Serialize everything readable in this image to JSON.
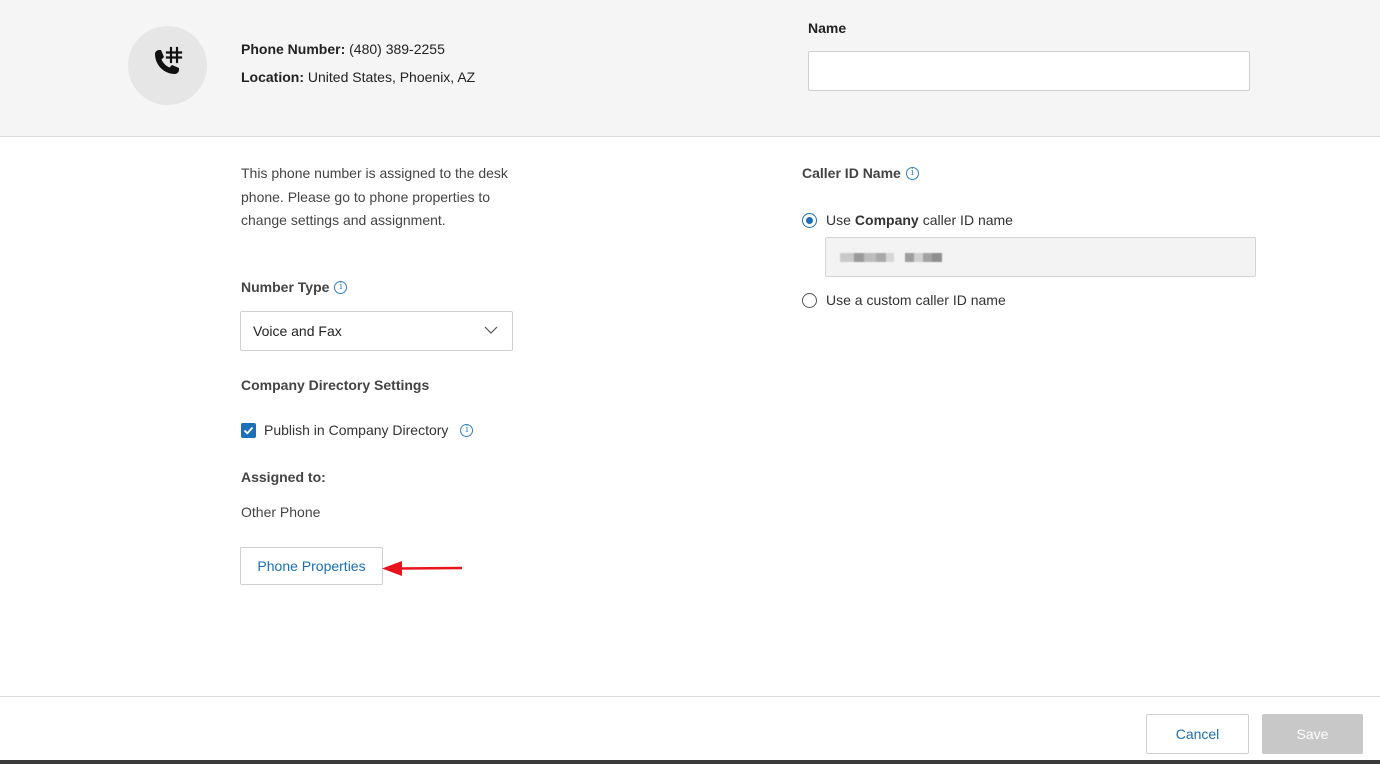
{
  "header": {
    "avatar_icon": "phone-hash-icon",
    "phone_number_label": "Phone Number:",
    "phone_number": "(480) 389-2255",
    "location_label": "Location:",
    "location": "United States, Phoenix, AZ",
    "name_label": "Name",
    "name_value": ""
  },
  "left": {
    "description": "This phone number is assigned to the desk phone. Please go to phone properties to change settings and assignment.",
    "number_type_label": "Number Type",
    "number_type_value": "Voice and Fax",
    "directory_settings_label": "Company Directory Settings",
    "publish_label": "Publish in Company Directory",
    "publish_checked": true,
    "assigned_to_label": "Assigned to:",
    "assigned_to_value": "Other Phone",
    "phone_properties_button": "Phone Properties"
  },
  "right": {
    "caller_id_label": "Caller ID Name",
    "option_company_prefix": "Use",
    "option_company_bold": "Company",
    "option_company_suffix": "caller ID name",
    "option_custom": "Use a custom caller ID name",
    "selected_option": "company"
  },
  "footer": {
    "cancel_label": "Cancel",
    "save_label": "Save"
  },
  "colors": {
    "accent": "#1d70b8",
    "link": "#1c6fb4",
    "annotation_arrow": "#e8141b",
    "disabled_button": "#c8c8c8"
  }
}
